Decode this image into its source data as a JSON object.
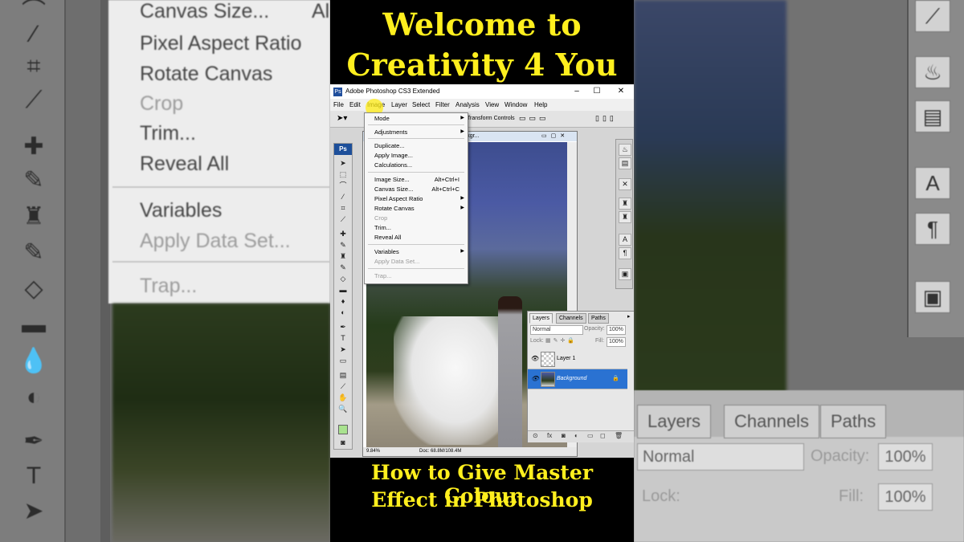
{
  "video": {
    "title_line1": "Welcome to",
    "title_line2": "Creativity 4 You",
    "subtitle_line1": "How to Give Master Colour",
    "subtitle_line2": "Effect in Photoshop",
    "title_color": "#ffef1e"
  },
  "photoshop": {
    "window_title": "Adobe Photoshop CS3 Extended",
    "menubar": [
      "File",
      "Edit",
      "Image",
      "Layer",
      "Select",
      "Filter",
      "Analysis",
      "View",
      "Window",
      "Help"
    ],
    "optionsbar_text": "Transform Controls",
    "doc_title": "@ 9.84% (Backgr...",
    "zoom": "9.84%",
    "doc_size": "Doc: 68.8M/108.4M",
    "ps_logo": "Ps"
  },
  "image_menu": {
    "items": {
      "mode": "Mode",
      "adjustments": "Adjustments",
      "duplicate": "Duplicate...",
      "apply_image": "Apply Image...",
      "calculations": "Calculations...",
      "image_size": "Image Size...",
      "image_size_sc": "Alt+Ctrl+I",
      "canvas_size": "Canvas Size...",
      "canvas_size_sc": "Alt+Ctrl+C",
      "pixel_aspect": "Pixel Aspect Ratio",
      "rotate_canvas": "Rotate Canvas",
      "crop": "Crop",
      "trim": "Trim...",
      "reveal_all": "Reveal All",
      "variables": "Variables",
      "apply_data_set": "Apply Data Set...",
      "trap": "Trap..."
    }
  },
  "layers_panel": {
    "tabs": [
      "Layers",
      "Channels",
      "Paths"
    ],
    "blend_mode": "Normal",
    "opacity_label": "Opacity:",
    "opacity": "100%",
    "lock_label": "Lock:",
    "fill_label": "Fill:",
    "fill": "100%",
    "layers": [
      "Layer 1",
      "Background"
    ]
  },
  "background_blur": {
    "left_menu": [
      "Canvas Size...",
      "Pixel Aspect Ratio",
      "Rotate Canvas",
      "Crop",
      "Trim...",
      "Reveal All",
      "Variables",
      "Apply Data Set...",
      "Trap..."
    ],
    "left_menu_shortcut": "Al",
    "right_tabs": [
      "Layers",
      "Channels",
      "Paths"
    ],
    "right_blend": "Normal",
    "right_opacity_label": "Opacity:",
    "right_opacity": "100%",
    "right_lock_label": "Lock:",
    "right_fill_label": "Fill:",
    "right_fill": "100%"
  }
}
